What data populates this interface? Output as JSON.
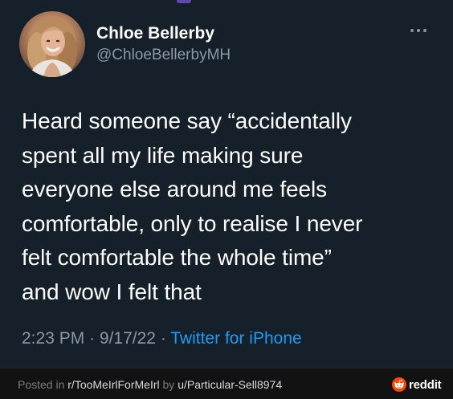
{
  "tweet": {
    "display_name": "Chloe Bellerby",
    "handle": "@ChloeBellerbyMH",
    "text_lines": [
      "Heard someone say “accidentally",
      "spent all my life making sure",
      "everyone else around me feels",
      "comfortable, only to realise I never",
      "felt comfortable the whole time”",
      "and wow I felt that"
    ],
    "time": "2:23 PM",
    "separator": "·",
    "date": "9/17/22",
    "source": "Twitter for iPhone",
    "more_icon": "more-horizontal-icon",
    "avatar_icon": "user-avatar"
  },
  "footer": {
    "posted_in_prefix": "Posted in ",
    "subreddit": "r/TooMeIrlForMeIrl",
    "by_text": " by ",
    "user": "u/Particular-Sell8974",
    "brand": "reddit",
    "brand_icon": "reddit-alien-icon"
  },
  "colors": {
    "background": "#15202b",
    "text_primary": "#ffffff",
    "text_secondary": "#8b98a5",
    "link": "#1d9bf0",
    "reddit_orange": "#ff4500",
    "footer_background": "#121212"
  }
}
